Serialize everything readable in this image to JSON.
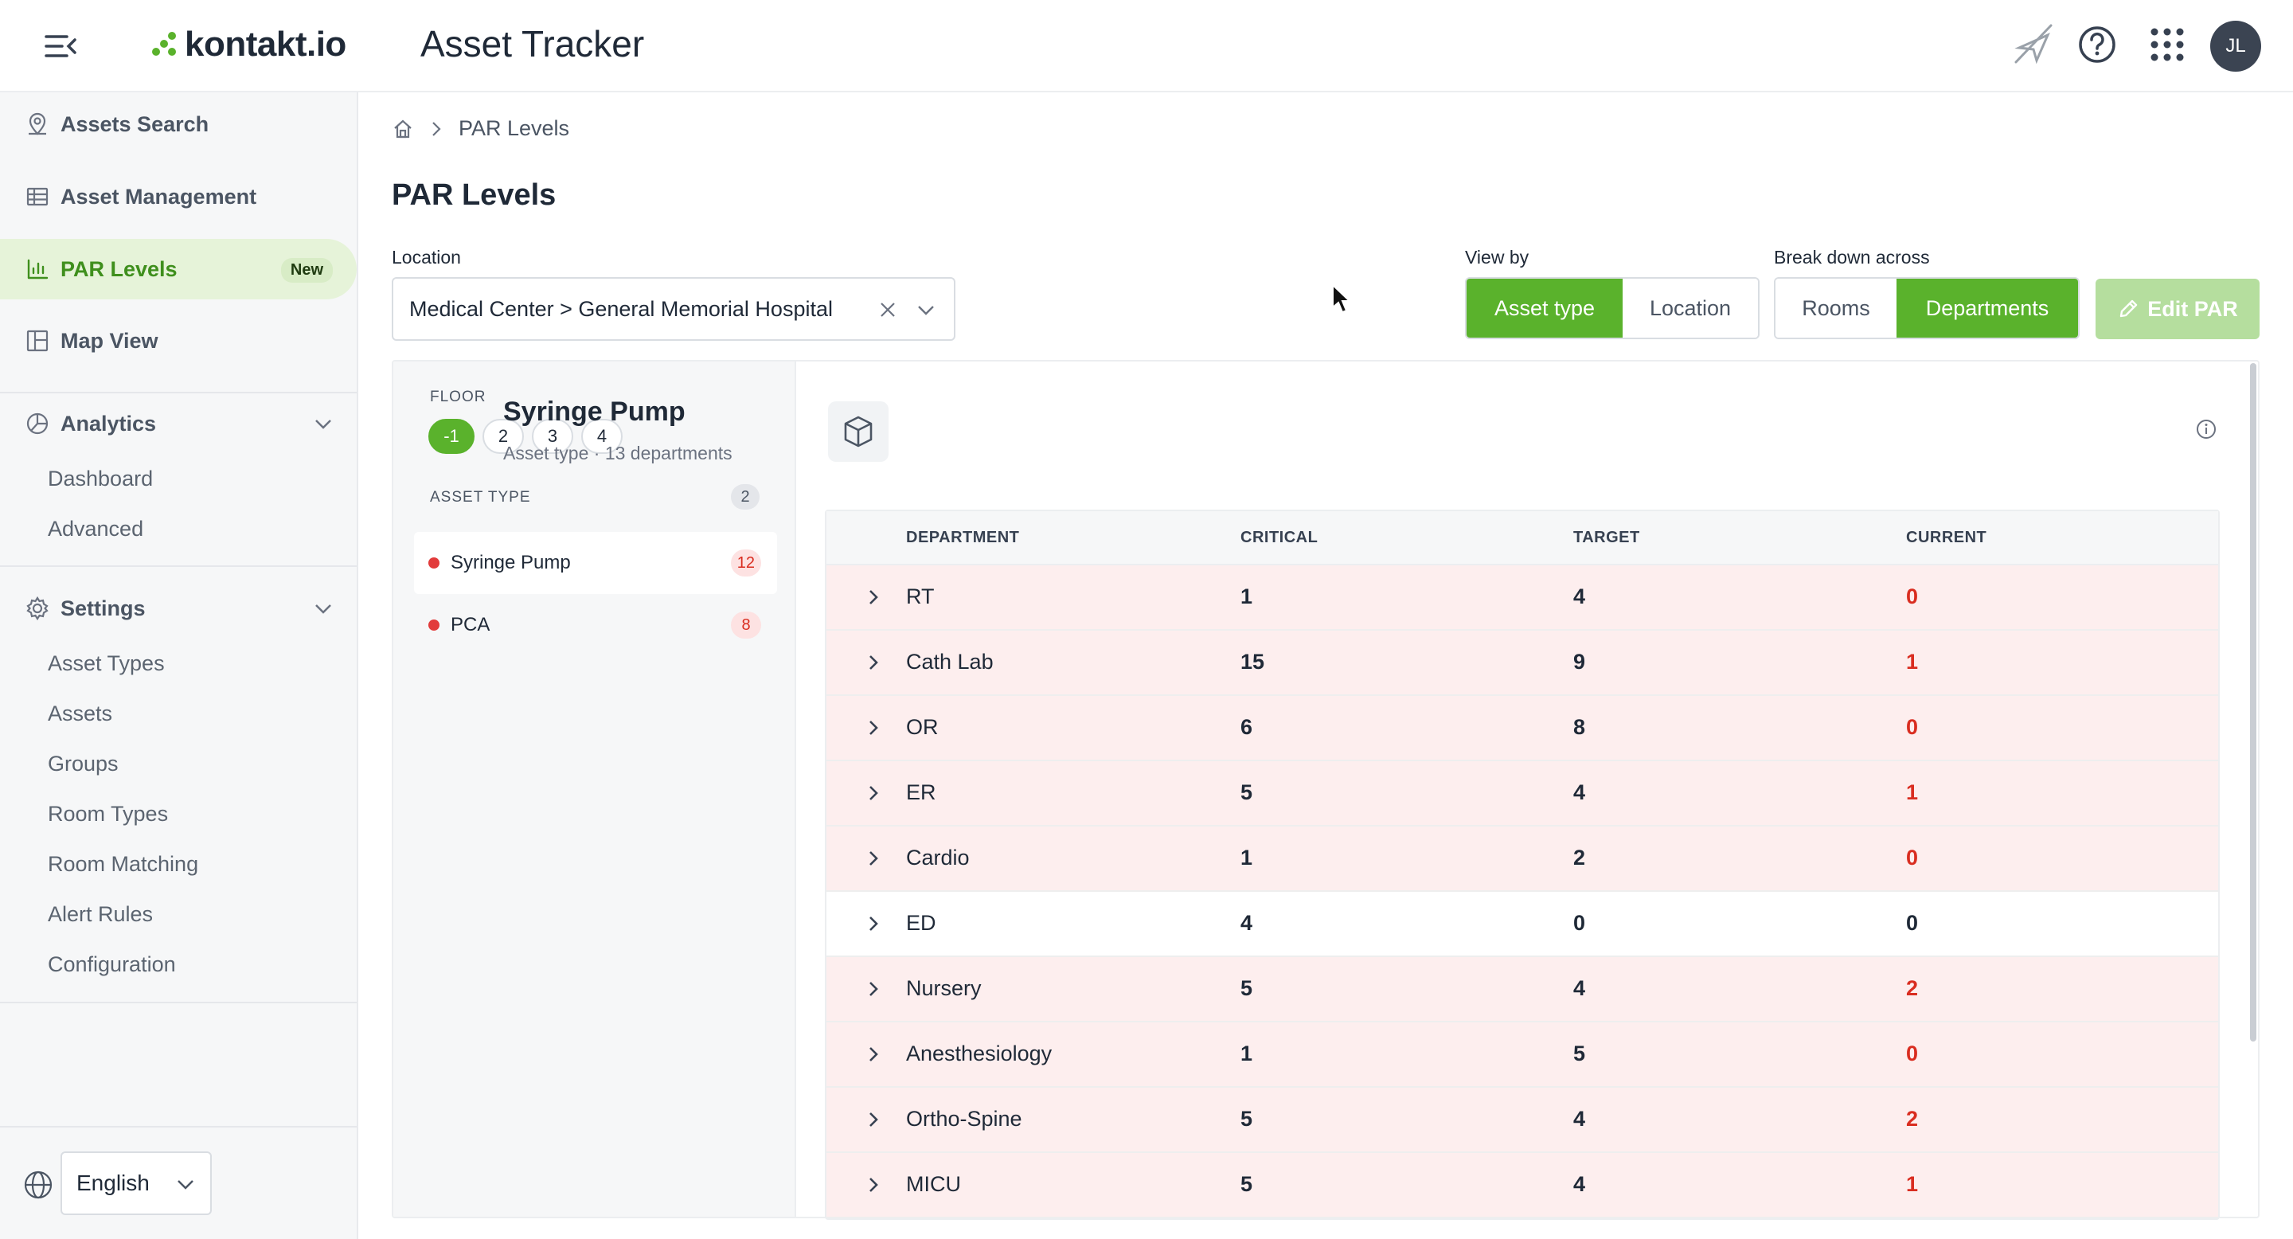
{
  "header": {
    "app_title": "Asset Tracker",
    "logo_text": "kontakt.io",
    "avatar_initials": "JL",
    "icons": [
      "menu-collapse-icon",
      "location-off-icon",
      "help-icon",
      "apps-grid-icon"
    ]
  },
  "sidebar": {
    "items": [
      {
        "label": "Assets Search",
        "icon": "location-pin-icon"
      },
      {
        "label": "Asset Management",
        "icon": "table-icon"
      },
      {
        "label": "PAR Levels",
        "icon": "bar-chart-icon",
        "badge": "New",
        "active": true
      },
      {
        "label": "Map View",
        "icon": "layout-icon"
      }
    ],
    "analytics": {
      "label": "Analytics",
      "children": [
        "Dashboard",
        "Advanced"
      ]
    },
    "settings": {
      "label": "Settings",
      "children": [
        "Asset Types",
        "Assets",
        "Groups",
        "Room Types",
        "Room Matching",
        "Alert Rules",
        "Configuration"
      ]
    },
    "language": "English"
  },
  "breadcrumb": {
    "current": "PAR Levels"
  },
  "page": {
    "title": "PAR Levels"
  },
  "filters": {
    "location_label": "Location",
    "location_value": "Medical Center > General Memorial Hospital",
    "view_by_label": "View by",
    "view_by_options": [
      "Asset type",
      "Location"
    ],
    "view_by_selected": "Asset type",
    "breakdown_label": "Break down across",
    "breakdown_options": [
      "Rooms",
      "Departments"
    ],
    "breakdown_selected": "Departments",
    "edit_button": "Edit PAR"
  },
  "left_pane": {
    "floor_label": "FLOOR",
    "floors": [
      "-1",
      "2",
      "3",
      "4"
    ],
    "floor_selected": "-1",
    "asset_type_label": "ASSET TYPE",
    "asset_type_count": "2",
    "asset_types": [
      {
        "name": "Syringe Pump",
        "count": "12",
        "selected": true
      },
      {
        "name": "PCA",
        "count": "8",
        "selected": false
      }
    ]
  },
  "detail": {
    "title": "Syringe Pump",
    "subtitle": "Asset type · 13 departments",
    "columns": [
      "DEPARTMENT",
      "CRITICAL",
      "TARGET",
      "CURRENT"
    ],
    "rows": [
      {
        "department": "RT",
        "critical": "1",
        "target": "4",
        "current": "0",
        "below": true
      },
      {
        "department": "Cath Lab",
        "critical": "15",
        "target": "9",
        "current": "1",
        "below": true
      },
      {
        "department": "OR",
        "critical": "6",
        "target": "8",
        "current": "0",
        "below": true
      },
      {
        "department": "ER",
        "critical": "5",
        "target": "4",
        "current": "1",
        "below": true
      },
      {
        "department": "Cardio",
        "critical": "1",
        "target": "2",
        "current": "0",
        "below": true
      },
      {
        "department": "ED",
        "critical": "4",
        "target": "0",
        "current": "0",
        "below": false
      },
      {
        "department": "Nursery",
        "critical": "5",
        "target": "4",
        "current": "2",
        "below": true
      },
      {
        "department": "Anesthesiology",
        "critical": "1",
        "target": "5",
        "current": "0",
        "below": true
      },
      {
        "department": "Ortho-Spine",
        "critical": "5",
        "target": "4",
        "current": "2",
        "below": true
      },
      {
        "department": "MICU",
        "critical": "5",
        "target": "4",
        "current": "1",
        "below": true
      }
    ]
  },
  "colors": {
    "accent": "#5ab22c",
    "alert": "#d92d20",
    "alert_row_bg": "#fdeeee"
  }
}
